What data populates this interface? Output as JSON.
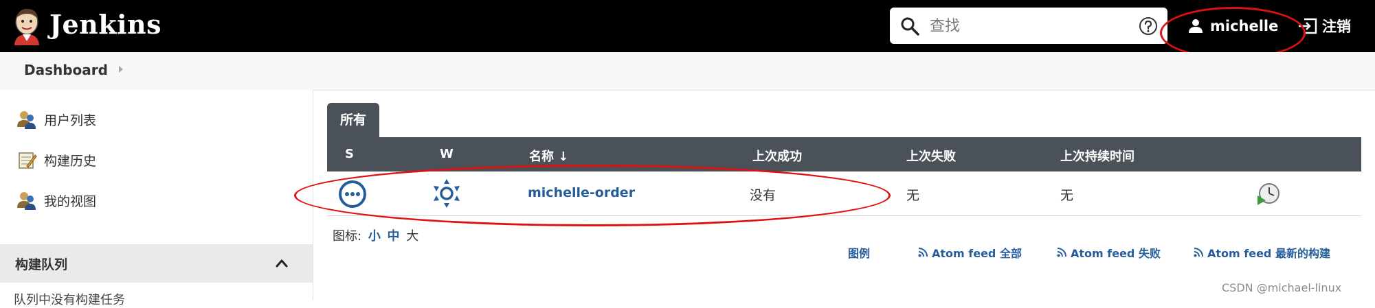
{
  "header": {
    "brand": "Jenkins",
    "search_placeholder": "查找",
    "user": "michelle",
    "logout": "注销"
  },
  "breadcrumb": {
    "item": "Dashboard"
  },
  "sidebar": {
    "items": [
      {
        "label": "用户列表",
        "icon": "people-icon"
      },
      {
        "label": "构建历史",
        "icon": "notepad-icon"
      },
      {
        "label": "我的视图",
        "icon": "people-icon"
      }
    ],
    "queue_title": "构建队列",
    "queue_empty": "队列中没有构建任务"
  },
  "view_tab": "所有",
  "table": {
    "headers": {
      "s": "S",
      "w": "W",
      "name": "名称 ↓",
      "last_success": "上次成功",
      "last_failure": "上次失败",
      "last_duration": "上次持续时间"
    },
    "rows": [
      {
        "name": "michelle-order",
        "last_success": "没有",
        "last_failure": "无",
        "last_duration": "无",
        "status": "not-built",
        "weather": "sunny"
      }
    ]
  },
  "icon_size": {
    "label": "图标:",
    "small": "小",
    "medium": "中",
    "large": "大"
  },
  "footer_links": {
    "legend": "图例",
    "atom_all": "Atom feed 全部",
    "atom_fail": "Atom feed 失败",
    "atom_latest": "Atom feed 最新的构建"
  },
  "watermark": "CSDN @michael-linux",
  "colors": {
    "header_bg": "#000000",
    "table_header_bg": "#4a5159",
    "link": "#245d99",
    "annotation_red": "#e01010"
  }
}
